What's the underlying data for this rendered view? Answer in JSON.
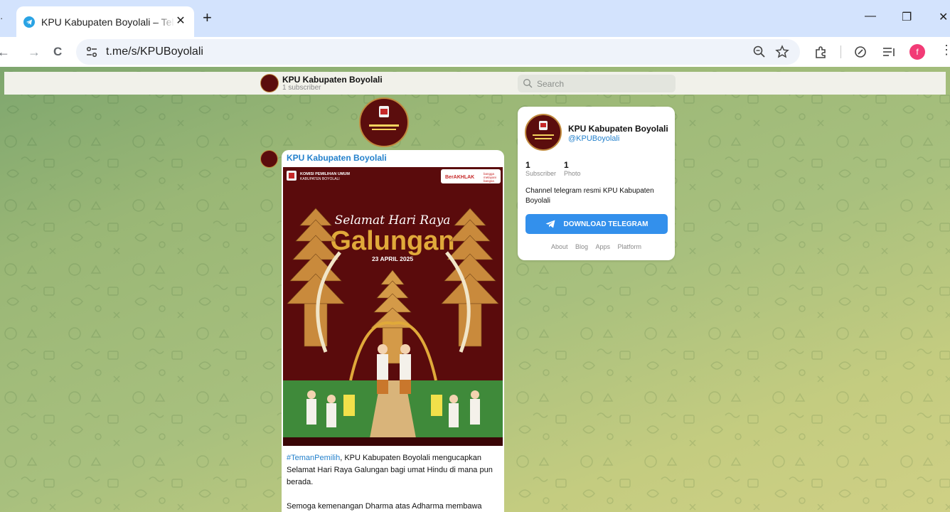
{
  "browser": {
    "tab_stub": "·",
    "tab_title": "KPU Kabupaten Boyolali – Telegram",
    "tab_close": "✕",
    "new_tab": "+",
    "minimize": "—",
    "restore": "❐",
    "close_partial": "✕",
    "back": "←",
    "forward": "→",
    "reload": "C",
    "url": "t.me/s/KPUBoyolali",
    "profile_initial": "f",
    "icons": [
      "site-info-icon",
      "zoom-icon",
      "bookmark-star-icon",
      "extensions-icon",
      "copilot-icon",
      "reading-list-icon",
      "profile-avatar",
      "more-menu-icon"
    ]
  },
  "header": {
    "channel_name": "KPU Kabupaten Boyolali",
    "subscribers": "1 subscriber",
    "search_placeholder": "Search"
  },
  "message": {
    "author": "KPU Kabupaten Boyolali",
    "poster": {
      "org_line1": "KOMISI PEMILIHAN UMUM",
      "org_line2": "KABUPATEN BOYOLALI",
      "badge": "BerAKHLAK",
      "badge_sub1": "bangga",
      "badge_sub2": "melayani",
      "badge_sub3": "bangsa",
      "script_title": "Selamat Hari Raya",
      "main_title": "Galungan",
      "date": "23 APRIL 2025"
    },
    "hashtag": "#TemanPemilih",
    "caption_p1": ", KPU Kabupaten Boyolali mengucapkan Selamat Hari Raya Galungan bagi umat Hindu di mana pun berada.",
    "caption_p2": "Semoga kemenangan Dharma atas Adharma membawa damai, kebahagiaan, dan kebaikan bagi kita semua."
  },
  "channel_card": {
    "name": "KPU Kabupaten Boyolali",
    "username": "@KPUBoyolali",
    "stats": [
      {
        "value": "1",
        "label": "Subscriber"
      },
      {
        "value": "1",
        "label": "Photo"
      }
    ],
    "description": "Channel telegram resmi KPU Kabupaten Boyolali",
    "download_button": "DOWNLOAD TELEGRAM",
    "links": [
      "About",
      "Blog",
      "Apps",
      "Platform"
    ]
  },
  "colors": {
    "accent_blue": "#2481cc",
    "button_blue": "#3390ec",
    "poster_bg": "#5a0b0c",
    "gold": "#e0a93a"
  }
}
